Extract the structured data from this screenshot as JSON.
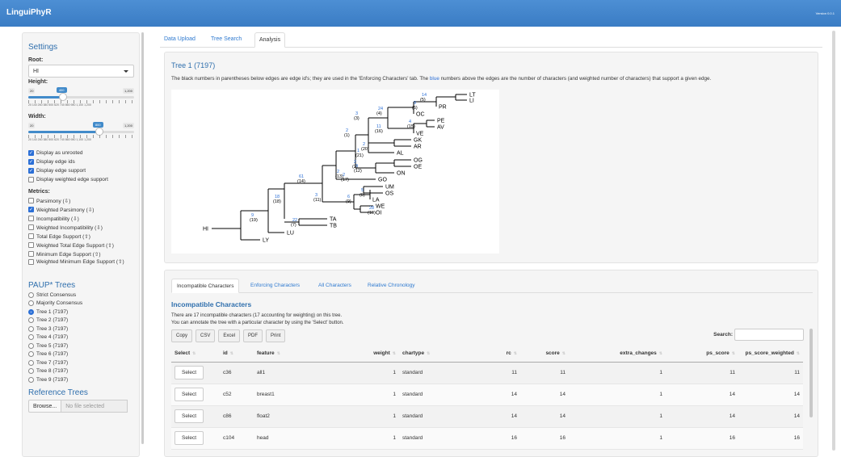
{
  "navbar": {
    "title": "LinguiPhyR",
    "version": "Version 0.0.1"
  },
  "sidebar": {
    "settings_title": "Settings",
    "root_label": "Root:",
    "root_value": "HI",
    "height": {
      "label": "Height:",
      "min": "20",
      "max": "1,200",
      "value": "400",
      "fraction": 0.322,
      "ticks": "20 140 260 380 500 620 740 860 980 1,100 1,200"
    },
    "width": {
      "label": "Width:",
      "min": "20",
      "max": "1,200",
      "value": "800",
      "fraction": 0.661,
      "ticks": "20 140 260 380 500 620 740 860 980 1,100 1,200"
    },
    "display_options": [
      {
        "label": "Display as unrooted",
        "checked": true
      },
      {
        "label": "Display edge ids",
        "checked": true
      },
      {
        "label": "Display edge support",
        "checked": true
      },
      {
        "label": "Display weighted edge support",
        "checked": false
      }
    ],
    "metrics_label": "Metrics:",
    "metrics": [
      {
        "label": "Parsimony (⇩)",
        "checked": false
      },
      {
        "label": "Weighted Parsimony (⇩)",
        "checked": true
      },
      {
        "label": "Incompatibility (⇩)",
        "checked": false
      },
      {
        "label": "Weighted Incompatibility (⇩)",
        "checked": false
      },
      {
        "label": "Total Edge Support (⇧)",
        "checked": false
      },
      {
        "label": "Weighted Total Edge Support (⇧)",
        "checked": false
      },
      {
        "label": "Minimum Edge Support (⇧)",
        "checked": false
      },
      {
        "label": "Weighted Minimum Edge Support (⇧)",
        "checked": false
      }
    ],
    "paup_title": "PAUP* Trees",
    "trees": [
      {
        "label": "Strict Consensus",
        "selected": false
      },
      {
        "label": "Majority Consensus",
        "selected": false
      },
      {
        "label": "Tree 1 (7197)",
        "selected": true
      },
      {
        "label": "Tree 2 (7197)",
        "selected": false
      },
      {
        "label": "Tree 3 (7197)",
        "selected": false
      },
      {
        "label": "Tree 4 (7197)",
        "selected": false
      },
      {
        "label": "Tree 5 (7197)",
        "selected": false
      },
      {
        "label": "Tree 6 (7197)",
        "selected": false
      },
      {
        "label": "Tree 7 (7197)",
        "selected": false
      },
      {
        "label": "Tree 8 (7197)",
        "selected": false
      },
      {
        "label": "Tree 9 (7197)",
        "selected": false
      }
    ],
    "ref_title": "Reference Trees",
    "browse_label": "Browse...",
    "file_placeholder": "No file selected"
  },
  "main_tabs": [
    {
      "label": "Data Upload",
      "active": false
    },
    {
      "label": "Tree Search",
      "active": false
    },
    {
      "label": "Analysis",
      "active": true
    }
  ],
  "tree_panel": {
    "title": "Tree 1 (7197)",
    "desc_a": "The black numbers in parentheses below edges are edge id's; they are used in the 'Enforcing Characters' tab. The ",
    "desc_blue": "blue",
    "desc_b": " numbers above the edges are the number of characters (and weighted number of characters) that support a given edge."
  },
  "tree": {
    "leaves": [
      "LT",
      "LI",
      "PR",
      "OC",
      "PE",
      "AV",
      "VE",
      "GK",
      "AR",
      "AL",
      "OG",
      "OE",
      "ON",
      "GO",
      "UM",
      "OS",
      "LA",
      "WE",
      "OI",
      "TA",
      "TB",
      "LU",
      "LY",
      "HI"
    ],
    "edge_labels": [
      {
        "support": "14",
        "id": "(5)"
      },
      {
        "support": "9",
        "id": "(6)"
      },
      {
        "support": "24",
        "id": "(4)"
      },
      {
        "support": "4",
        "id": "(15)"
      },
      {
        "support": "11",
        "id": "(16)"
      },
      {
        "support": "3",
        "id": "(3)"
      },
      {
        "support": "2",
        "id": "(1)"
      },
      {
        "support": "2",
        "id": "(20)"
      },
      {
        "support": "1",
        "id": "(21)"
      },
      {
        "support": "2",
        "id": "(2)"
      },
      {
        "support": "9",
        "id": "(12)"
      },
      {
        "support": "2",
        "id": "(13)"
      },
      {
        "support": "61",
        "id": "(14)"
      },
      {
        "support": "2",
        "id": "(17)"
      },
      {
        "support": "5",
        "id": "(8)"
      },
      {
        "support": "6",
        "id": "(9)"
      },
      {
        "support": "3",
        "id": "(11)"
      },
      {
        "support": "28",
        "id": "(10)"
      },
      {
        "support": "18",
        "id": "(18)"
      },
      {
        "support": "22",
        "id": "(7)"
      },
      {
        "support": "9",
        "id": "(19)"
      }
    ]
  },
  "lower_tabs": [
    {
      "label": "Incompatible Characters",
      "active": true
    },
    {
      "label": "Enforcing Characters",
      "active": false
    },
    {
      "label": "All Characters",
      "active": false
    },
    {
      "label": "Relative Chronology",
      "active": false
    }
  ],
  "table_section": {
    "title": "Incompatible Characters",
    "info1": "There are 17 incompatible characters (17 accounting for weighting) on this tree.",
    "info2": "You can annotate the tree with a particular character by using the 'Select' button.",
    "export_buttons": [
      "Copy",
      "CSV",
      "Excel",
      "PDF",
      "Print"
    ],
    "search_label": "Search:",
    "columns": [
      "Select",
      "id",
      "feature",
      "weight",
      "chartype",
      "rc",
      "score",
      "extra_changes",
      "ps_score",
      "ps_score_weighted"
    ],
    "select_label": "Select",
    "rows": [
      {
        "id": "c36",
        "feature": "all1",
        "weight": "1",
        "chartype": "standard",
        "rc": "11",
        "score": "11",
        "extra_changes": "1",
        "ps_score": "11",
        "ps_score_weighted": "11"
      },
      {
        "id": "c52",
        "feature": "breast1",
        "weight": "1",
        "chartype": "standard",
        "rc": "14",
        "score": "14",
        "extra_changes": "1",
        "ps_score": "14",
        "ps_score_weighted": "14"
      },
      {
        "id": "c86",
        "feature": "float2",
        "weight": "1",
        "chartype": "standard",
        "rc": "14",
        "score": "14",
        "extra_changes": "1",
        "ps_score": "14",
        "ps_score_weighted": "14"
      },
      {
        "id": "c104",
        "feature": "head",
        "weight": "1",
        "chartype": "standard",
        "rc": "16",
        "score": "16",
        "extra_changes": "1",
        "ps_score": "16",
        "ps_score_weighted": "16"
      }
    ]
  },
  "colors": {
    "navbar": "#3a7cc4",
    "link": "#2f7ad0",
    "checkbox": "#2b6fd6"
  }
}
